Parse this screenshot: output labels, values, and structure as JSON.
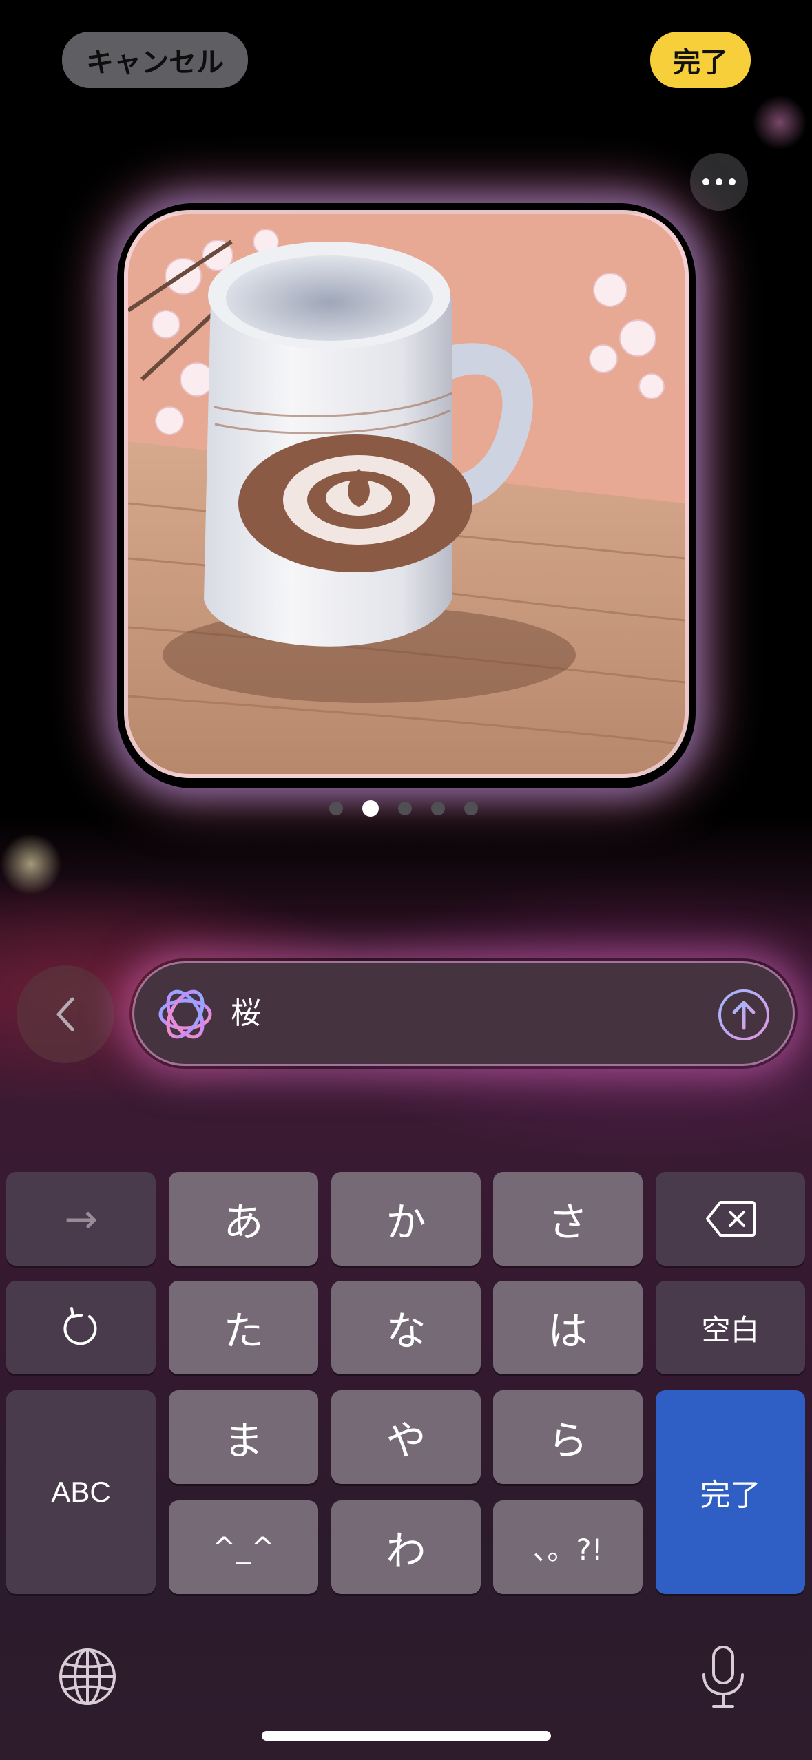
{
  "header": {
    "cancel_label": "キャンセル",
    "done_label": "完了"
  },
  "image_preview": {
    "page_count": 5,
    "current_page": 2
  },
  "prompt": {
    "text": "桜"
  },
  "keyboard": {
    "rows": [
      [
        "→",
        "あ",
        "か",
        "さ",
        "delete"
      ],
      [
        "undo",
        "た",
        "な",
        "は",
        "空白"
      ],
      [
        "ABC",
        "ま",
        "や",
        "ら",
        "完了"
      ],
      [
        "^_^",
        "わ",
        "、。?!"
      ]
    ],
    "key_arrow": "→",
    "key_a": "あ",
    "key_ka": "か",
    "key_sa": "さ",
    "key_ta": "た",
    "key_na": "な",
    "key_ha": "は",
    "key_space": "空白",
    "key_abc": "ABC",
    "key_ma": "ま",
    "key_ya": "や",
    "key_ra": "ら",
    "key_emoticon": "^_^",
    "key_wa": "わ",
    "key_punct": "、。?!",
    "key_done": "完了"
  },
  "colors": {
    "done_accent": "#f6cf3a",
    "keyboard_done": "#2f5ec4"
  },
  "icons": [
    "more-icon",
    "chevron-left-icon",
    "apple-intelligence-icon",
    "send-arrow-icon",
    "delete-icon",
    "undo-icon",
    "globe-icon",
    "microphone-icon"
  ]
}
